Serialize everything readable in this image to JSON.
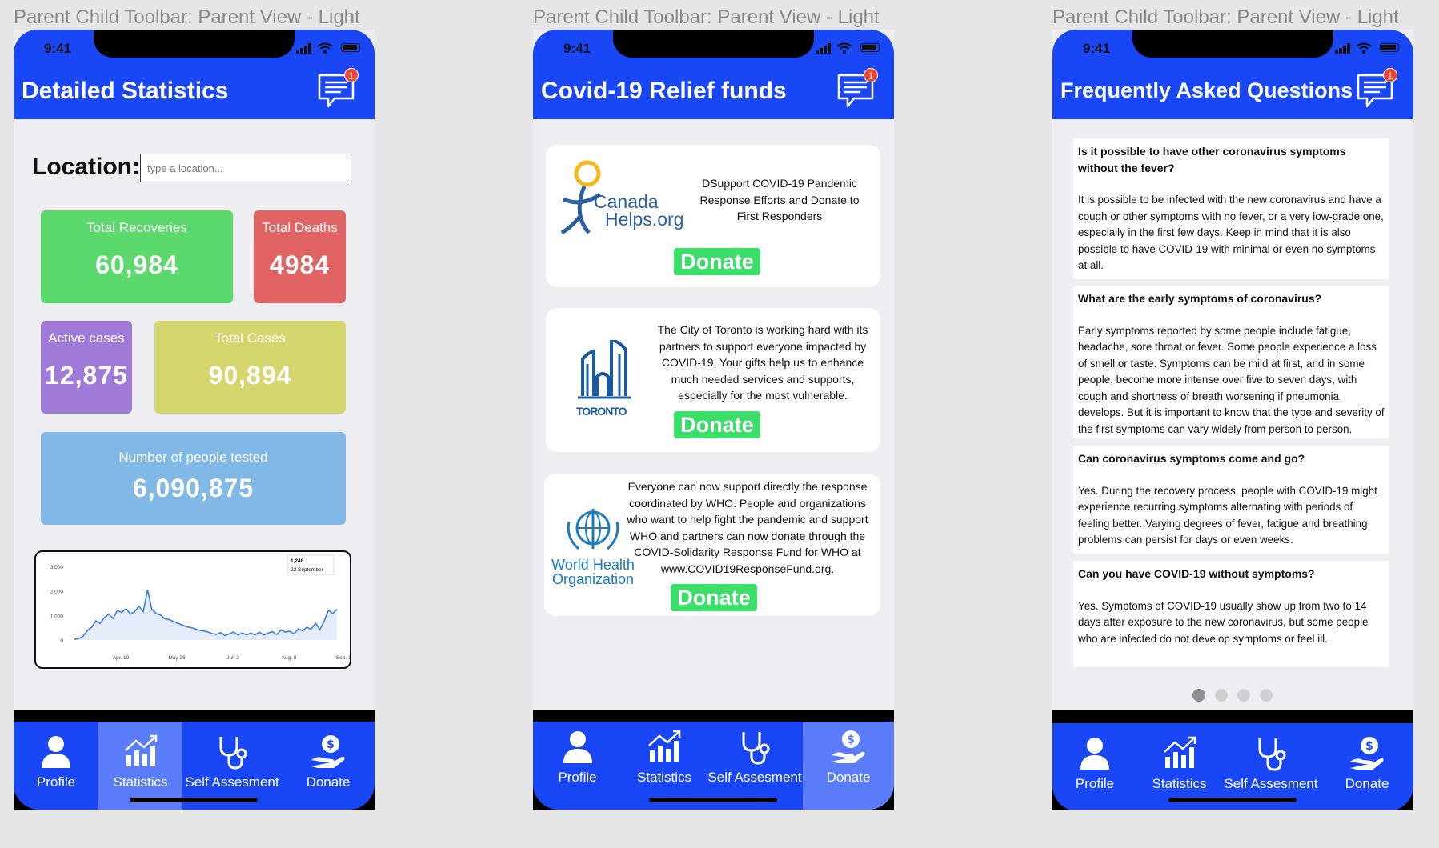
{
  "frames": [
    {
      "label": "Parent Child Toolbar: Parent View - Light",
      "title": "Detailed Statistics"
    },
    {
      "label": "Parent Child Toolbar: Parent View - Light",
      "title": "Covid-19 Relief funds"
    },
    {
      "label": "Parent Child Toolbar: Parent View - Light",
      "title": "Frequently Asked Questions"
    }
  ],
  "status": {
    "time": "9:41",
    "badge": "1"
  },
  "tabs": {
    "profile": "Profile",
    "statistics": "Statistics",
    "self": "Self Assesment",
    "donate": "Donate"
  },
  "stats": {
    "location_label": "Location:",
    "location_placeholder": "type a location...",
    "recoveries": {
      "label": "Total Recoveries",
      "value": "60,984",
      "color": "#5bd96d"
    },
    "deaths": {
      "label": "Total Deaths",
      "value": "4984",
      "color": "#e06464"
    },
    "active": {
      "label": "Active cases",
      "value": "12,875",
      "color": "#a07ad8"
    },
    "total": {
      "label": "Total Cases",
      "value": "90,894",
      "color": "#d6d66e"
    },
    "tested": {
      "label": "Number of people tested",
      "value": "6,090,875",
      "color": "#82b8e6"
    }
  },
  "chart_data": {
    "type": "line",
    "y_ticks": [
      "3,000",
      "2,000",
      "1,000",
      "0"
    ],
    "x_ticks": [
      "Apr. 19",
      "May 26",
      "Jul. 2",
      "Aug. 8",
      "Sep. 14"
    ],
    "ylim": [
      0,
      3000
    ],
    "tooltip": {
      "value": "1,248",
      "date": "22 September"
    },
    "values": [
      20,
      60,
      150,
      380,
      520,
      780,
      680,
      920,
      1050,
      880,
      1210,
      1120,
      1280,
      1060,
      1150,
      1380,
      1150,
      2050,
      1250,
      1080,
      1020,
      870,
      830,
      760,
      680,
      620,
      540,
      510,
      460,
      400,
      370,
      330,
      260,
      230,
      300,
      180,
      250,
      330,
      200,
      290,
      210,
      280,
      210,
      320,
      200,
      280,
      340,
      220,
      410,
      320,
      360,
      250,
      450,
      380,
      520,
      440,
      690,
      420,
      760,
      1210,
      1080,
      1248
    ]
  },
  "donations": [
    {
      "org": "CanadaHelps.org",
      "logo_line1": "Canada",
      "logo_line2": "Helps.org",
      "text": "DSupport COVID-19 Pandemic Response Efforts and Donate to First Responders",
      "button": "Donate"
    },
    {
      "org": "Toronto",
      "logo_text": "TORONTO",
      "text": "The City of Toronto is working hard with its partners to support everyone impacted by COVID-19. Your gifts help us to enhance much needed services and supports, especially for the most vulnerable.",
      "button": "Donate"
    },
    {
      "org": "World Health Organization",
      "logo_line1": "World Health",
      "logo_line2": "Organization",
      "text": "Everyone can now support directly the response coordinated by WHO. People and organizations who want to help fight the pandemic and support WHO and partners can now donate through the COVID-Solidarity Response Fund for WHO at www.COVID19ResponseFund.org.",
      "button": "Donate"
    }
  ],
  "faq": [
    {
      "q": "Is it possible to have other coronavirus symptoms without the fever?",
      "a": "It is possible to be infected with the new coronavirus and have a cough or other symptoms with no fever, or a very low-grade one, especially in the first few days. Keep in mind that it is also possible to have COVID-19 with minimal or even no symptoms at all."
    },
    {
      "q": "What are the early symptoms of coronavirus?",
      "a": "Early symptoms reported by some people include fatigue, headache, sore throat or fever. Some people experience a loss of smell or taste. Symptoms can be mild at first, and in some people, become more intense over five to seven days, with cough and shortness of breath worsening if pneumonia develops. But it is important to know that the type and severity of the first symptoms can vary widely from person to person."
    },
    {
      "q": "Can coronavirus symptoms come and go?",
      "a": "Yes. During the recovery process, people with COVID-19 might experience recurring symptoms alternating with periods of feeling better. Varying degrees of fever, fatigue and breathing problems can persist for days or even weeks."
    },
    {
      "q": "Can you have COVID-19 without symptoms?",
      "a": "Yes. Symptoms of COVID-19 usually show up from two to 14 days after exposure to the new coronavirus, but some people who are infected do not develop symptoms or feel ill."
    }
  ],
  "pagination": {
    "count": 4,
    "active": 0
  }
}
